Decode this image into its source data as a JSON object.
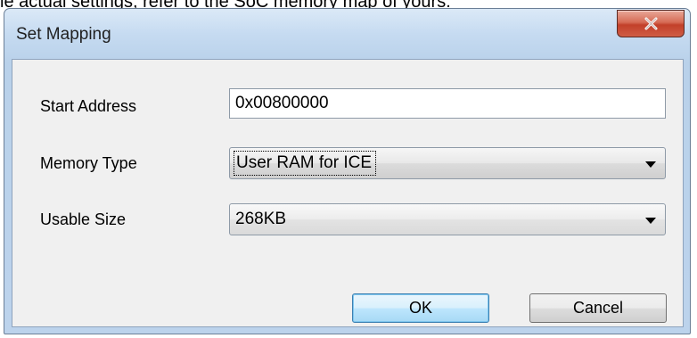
{
  "doc_text": "le actual settings, refer to the SoC memory map of yours.",
  "window": {
    "title": "Set Mapping"
  },
  "form": {
    "start_address_label": "Start Address",
    "start_address_value": "0x00800000",
    "memory_type_label": "Memory Type",
    "memory_type_value": "User RAM for ICE",
    "usable_size_label": "Usable Size",
    "usable_size_value": "268KB"
  },
  "buttons": {
    "ok": "OK",
    "cancel": "Cancel"
  },
  "colors": {
    "close_button": "#c94a33",
    "ok_border": "#3c7fb1",
    "frame": "#bcd3ec",
    "client": "#f0f0f0"
  },
  "icons": {
    "close": "close-icon",
    "dropdown": "chevron-down-icon"
  }
}
